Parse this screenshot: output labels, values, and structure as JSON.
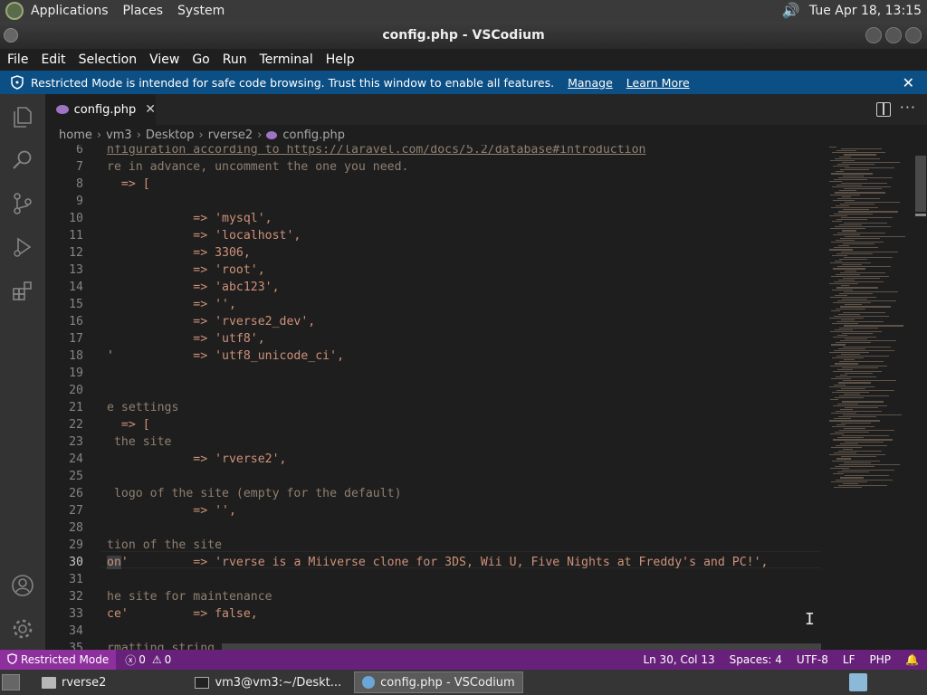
{
  "top_panel": {
    "menus": [
      "Applications",
      "Places",
      "System"
    ],
    "clock": "Tue Apr 18, 13:15"
  },
  "window": {
    "title": "config.php - VSCodium"
  },
  "menubar": [
    "File",
    "Edit",
    "Selection",
    "View",
    "Go",
    "Run",
    "Terminal",
    "Help"
  ],
  "banner": {
    "text": "Restricted Mode is intended for safe code browsing. Trust this window to enable all features.",
    "manage": "Manage",
    "learn_more": "Learn More"
  },
  "tab": {
    "label": "config.php"
  },
  "breadcrumb": [
    "home",
    "vm3",
    "Desktop",
    "rverse2",
    "config.php"
  ],
  "editor": {
    "lines": [
      {
        "n": "6",
        "text": "nfiguration according to https://laravel.com/docs/5.2/database#introduction"
      },
      {
        "n": "7",
        "text": "re in advance, uncomment the one you need."
      },
      {
        "n": "8",
        "text": "  => ["
      },
      {
        "n": "9",
        "text": ""
      },
      {
        "n": "10",
        "text": "            => 'mysql',"
      },
      {
        "n": "11",
        "text": "            => 'localhost',"
      },
      {
        "n": "12",
        "text": "            => 3306,"
      },
      {
        "n": "13",
        "text": "            => 'root',"
      },
      {
        "n": "14",
        "text": "            => 'abc123',"
      },
      {
        "n": "15",
        "text": "            => '',"
      },
      {
        "n": "16",
        "text": "            => 'rverse2_dev',"
      },
      {
        "n": "17",
        "text": "            => 'utf8',"
      },
      {
        "n": "18",
        "text": "'           => 'utf8_unicode_ci',"
      },
      {
        "n": "19",
        "text": ""
      },
      {
        "n": "20",
        "text": ""
      },
      {
        "n": "21",
        "text": "e settings"
      },
      {
        "n": "22",
        "text": "  => ["
      },
      {
        "n": "23",
        "text": " the site"
      },
      {
        "n": "24",
        "text": "            => 'rverse2',"
      },
      {
        "n": "25",
        "text": ""
      },
      {
        "n": "26",
        "text": " logo of the site (empty for the default)"
      },
      {
        "n": "27",
        "text": "            => '',"
      },
      {
        "n": "28",
        "text": ""
      },
      {
        "n": "29",
        "text": "tion of the site"
      },
      {
        "n": "30",
        "text": "on'         => 'rverse is a Miiverse clone for 3DS, Wii U, Five Nights at Freddy's and PC!',"
      },
      {
        "n": "31",
        "text": ""
      },
      {
        "n": "32",
        "text": "he site for maintenance"
      },
      {
        "n": "33",
        "text": "ce'         => false,"
      },
      {
        "n": "34",
        "text": ""
      },
      {
        "n": "35",
        "text": "rmatting string"
      }
    ]
  },
  "statusbar": {
    "restricted": "Restricted Mode",
    "errors": "0",
    "warnings": "0",
    "position": "Ln 30, Col 13",
    "spaces": "Spaces: 4",
    "encoding": "UTF-8",
    "eol": "LF",
    "language": "PHP"
  },
  "taskbar": {
    "items": [
      "rverse2",
      "vm3@vm3:~/Deskt...",
      "config.php - VSCodium"
    ]
  }
}
